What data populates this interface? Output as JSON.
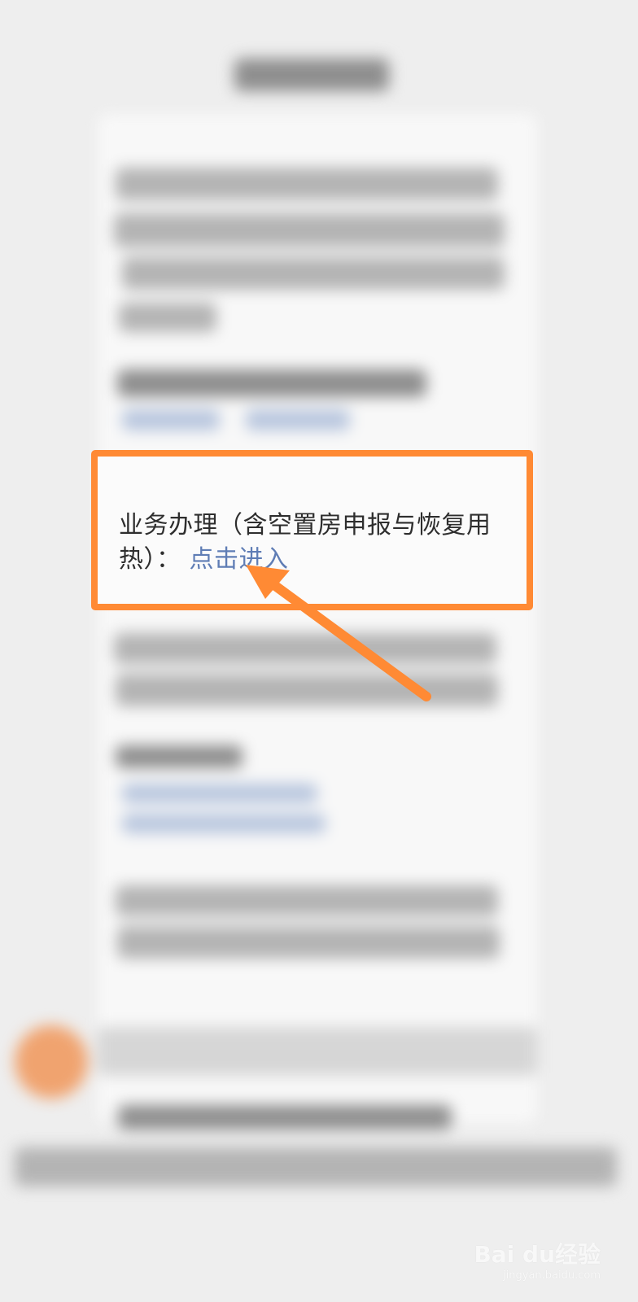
{
  "dialog": {
    "text_prefix": "业务办理（含空置房申报与恢复用热）：",
    "link_text": "点击进入"
  },
  "watermark": {
    "main": "Bai du经验",
    "sub": "jingyan.baidu.com"
  },
  "colors": {
    "highlight": "#ff8a34",
    "link": "#5f7db5"
  },
  "icons": {
    "arrow": "arrow-icon",
    "watermark": "baidu-watermark"
  }
}
